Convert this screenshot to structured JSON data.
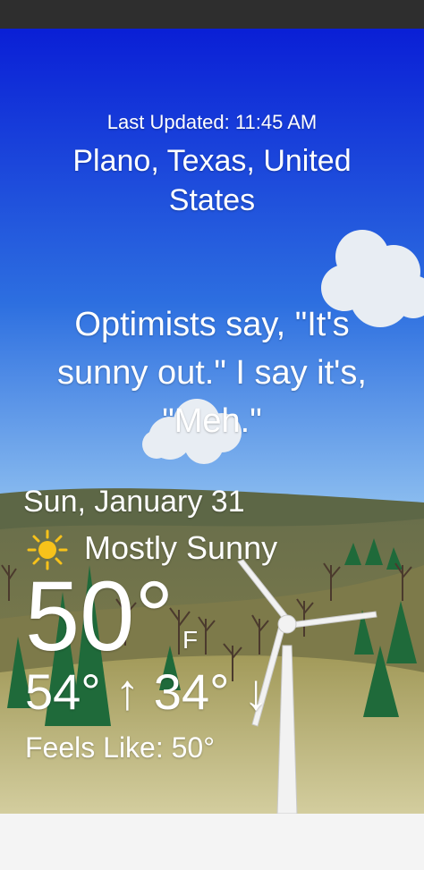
{
  "weather": {
    "last_updated": "Last Updated: 11:45 AM",
    "location": "Plano, Texas, United States",
    "quote": "Optimists say, \"It's sunny out.\" I say it's, \"Meh.\"",
    "date": "Sun, January 31",
    "condition": "Mostly Sunny",
    "condition_icon": "sun-icon",
    "temperature": "50°",
    "unit": "F",
    "hi_lo": "54° ↑ 34° ↓",
    "feels_like": "Feels Like: 50°"
  },
  "colors": {
    "sky_top": "#0a1fd6",
    "sky_bottom": "#8fc0f0",
    "hill": "#7d7a4a",
    "sun": "#f7c21a"
  }
}
